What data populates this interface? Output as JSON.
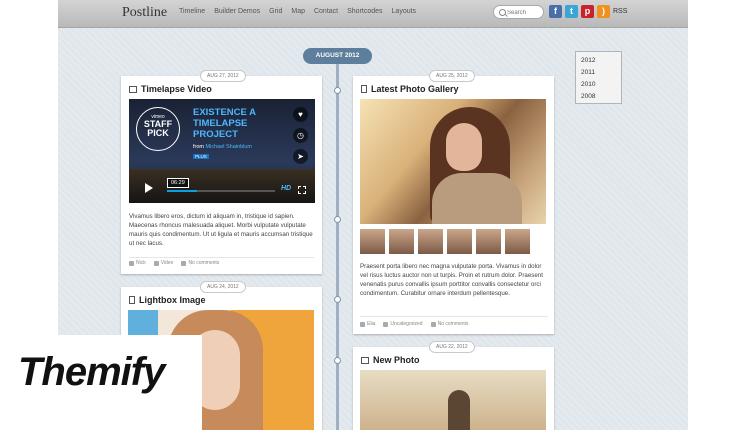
{
  "header": {
    "logo": "Postline",
    "nav": [
      "Timeline",
      "Builder Demos",
      "Grid",
      "Map",
      "Contact",
      "Shortcodes",
      "Layouts"
    ],
    "search_placeholder": "Search",
    "rss_label": "RSS",
    "social_icons": [
      "facebook-icon",
      "twitter-icon",
      "pinterest-icon",
      "rss-icon"
    ]
  },
  "timeline": {
    "month_label": "AUGUST 2012",
    "years": [
      "2012",
      "2011",
      "2010",
      "2008"
    ]
  },
  "posts": {
    "timelapse": {
      "date": "AUG 27, 2012",
      "title": "Timelapse Video",
      "video": {
        "badge_small": "vimeo",
        "badge_big_1": "STAFF",
        "badge_big_2": "PICK",
        "title_1": "EXISTENCE A",
        "title_2": "TIMELAPSE",
        "title_3": "PROJECT",
        "from_prefix": "from",
        "from_author": "Michael Shainblum",
        "plus": "PLUS",
        "time": "06:29",
        "progress": 0.28,
        "hd": "HD"
      },
      "excerpt": "Vivamus libero eros, dictum id aliquam in, tristique id sapien. Maecenas rhoncus malesuada aliquet. Morbi vulputate vulputate mauris quis condimentum. Ut ut ligula et mauris accumsan tristique ut nec lacus.",
      "author": "Nick",
      "category": "Video",
      "comments": "No comments"
    },
    "gallery": {
      "date": "AUG 25, 2012",
      "title": "Latest Photo Gallery",
      "excerpt": "Praesent porta libero nec magna vulputate porta. Vivamus in dolor vel risus luctus auctor non ut turpis. Proin et rutrum dolor. Praesent venenatis purus convallis ipsum porttitor convallis consectetur orci condimentum. Curabitur ornare interdum pellentesque.",
      "author": "Elia",
      "category": "Uncategorized",
      "comments": "No comments"
    },
    "lightbox": {
      "date": "AUG 24, 2012",
      "title": "Lightbox Image"
    },
    "newphoto": {
      "date": "AUG 22, 2012",
      "title": "New Photo"
    }
  },
  "watermark": "Themify"
}
